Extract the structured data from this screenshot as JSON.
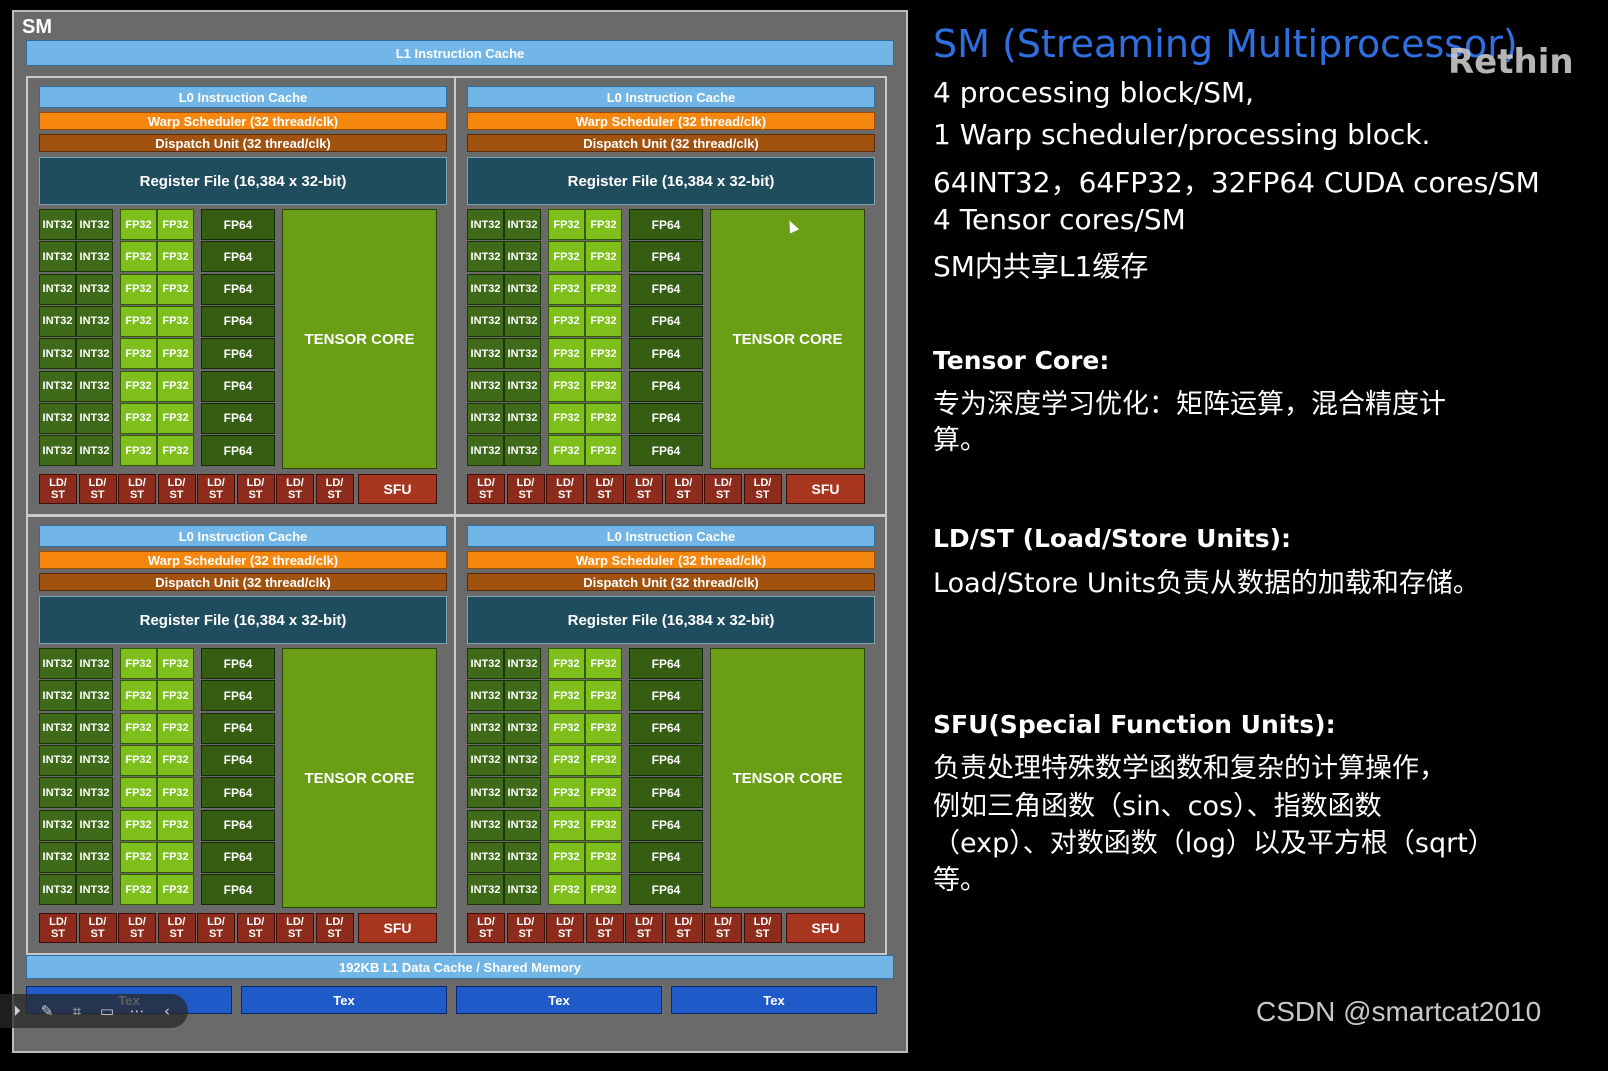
{
  "diagram": {
    "sm_label": "SM",
    "l1_instruction_cache": "L1 Instruction Cache",
    "block": {
      "l0_cache": "L0 Instruction Cache",
      "warp_scheduler": "Warp Scheduler (32 thread/clk)",
      "dispatch_unit": "Dispatch Unit (32 thread/clk)",
      "register_file": "Register File (16,384 x 32-bit)",
      "int32": "INT32",
      "fp32": "FP32",
      "fp64": "FP64",
      "tensor_core": "TENSOR CORE",
      "ldst": "LD/\nST",
      "sfu": "SFU"
    },
    "l1_data_cache": "192KB L1 Data Cache / Shared Memory",
    "tex": [
      "Tex",
      "Tex",
      "Tex",
      "Tex"
    ]
  },
  "toolbar": {
    "icons": [
      "play-icon",
      "pen-icon",
      "crop-icon",
      "screen-icon",
      "more-icon",
      "collapse-icon"
    ]
  },
  "panel": {
    "title": "SM (Streaming Multiprocessor)",
    "overlay": "Rethin",
    "lines": [
      "4 processing block/SM,",
      "1 Warp scheduler/processing block.",
      "64INT32，64FP32，32FP64 CUDA cores/SM",
      "4 Tensor cores/SM",
      "SM内共享L1缓存"
    ],
    "tensor_heading": "Tensor Core:",
    "tensor_body": [
      "专为深度学习优化：矩阵运算，混合精度计",
      "算。"
    ],
    "ldst_heading": "LD/ST (Load/Store Units):",
    "ldst_body": [
      "Load/Store Units负责从数据的加载和存储。"
    ],
    "sfu_heading": "SFU(Special Function Units):",
    "sfu_body": [
      "负责处理特殊数学函数和复杂的计算操作，",
      "例如三角函数（sin、cos）、指数函数",
      "（exp）、对数函数（log）以及平方根（sqrt）",
      "等。"
    ]
  },
  "watermark": "CSDN @smartcat2010"
}
